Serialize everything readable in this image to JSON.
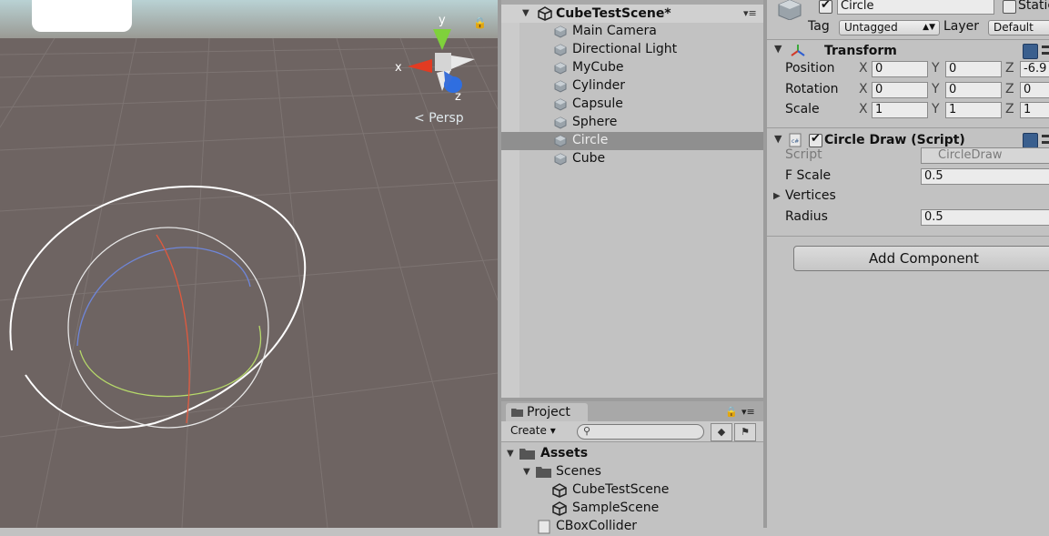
{
  "scene_view": {
    "persp_label": "Persp",
    "axis_y": "y",
    "axis_x": "x",
    "axis_z": "z",
    "background": "#6e6462",
    "sky_color": "#a7c6c9"
  },
  "hierarchy": {
    "scene_name": "CubeTestScene*",
    "items": [
      {
        "label": "Main Camera",
        "selected": false
      },
      {
        "label": "Directional Light",
        "selected": false
      },
      {
        "label": "MyCube",
        "selected": false
      },
      {
        "label": "Cylinder",
        "selected": false
      },
      {
        "label": "Capsule",
        "selected": false
      },
      {
        "label": "Sphere",
        "selected": false
      },
      {
        "label": "Circle",
        "selected": true
      },
      {
        "label": "Cube",
        "selected": false
      }
    ]
  },
  "project": {
    "tab_label": "Project",
    "create_label": "Create",
    "tree": [
      {
        "label": "Assets",
        "bold": true
      },
      {
        "label": "Scenes",
        "bold": false
      },
      {
        "label": "CubeTestScene",
        "bold": false
      },
      {
        "label": "SampleScene",
        "bold": false
      },
      {
        "label": "CBoxCollider",
        "bold": false
      }
    ]
  },
  "inspector": {
    "object_name": "Circle",
    "static_label": "Static",
    "tag_label": "Tag",
    "tag_value": "Untagged",
    "layer_label": "Layer",
    "layer_value": "Default",
    "transform": {
      "title": "Transform",
      "position_label": "Position",
      "rotation_label": "Rotation",
      "scale_label": "Scale",
      "axis_x": "X",
      "axis_y": "Y",
      "axis_z": "Z",
      "position": {
        "x": "0",
        "y": "0",
        "z": "-6.9"
      },
      "rotation": {
        "x": "0",
        "y": "0",
        "z": "0"
      },
      "scale": {
        "x": "1",
        "y": "1",
        "z": "1"
      }
    },
    "circle_draw": {
      "title": "Circle Draw (Script)",
      "script_label": "Script",
      "script_value": "CircleDraw",
      "fscale_label": "F Scale",
      "fscale_value": "0.5",
      "vertices_label": "Vertices",
      "radius_label": "Radius",
      "radius_value": "0.5"
    },
    "add_component_label": "Add Component"
  }
}
